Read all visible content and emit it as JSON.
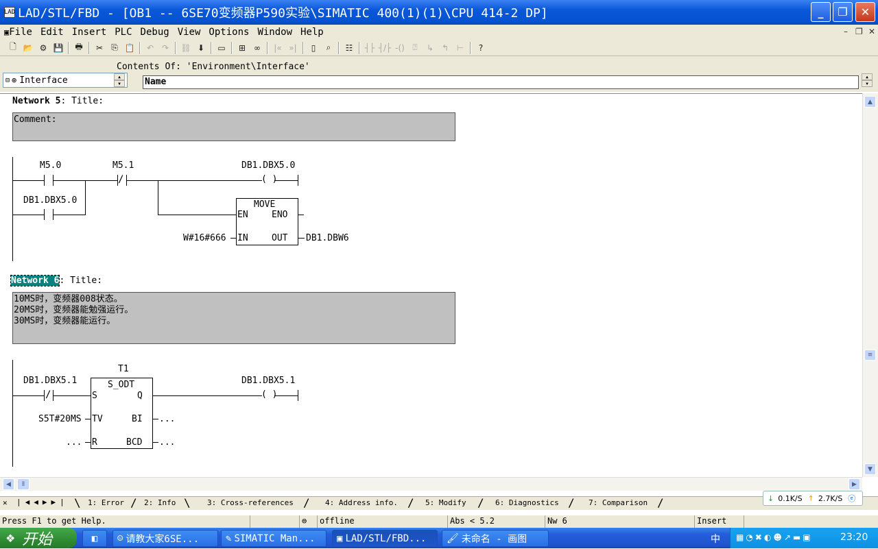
{
  "window": {
    "title": "LAD/STL/FBD  - [OB1 -- 6SE70变频器P590实验\\SIMATIC 400(1)(1)\\CPU 414-2 DP]"
  },
  "menu": [
    "File",
    "Edit",
    "Insert",
    "PLC",
    "Debug",
    "View",
    "Options",
    "Window",
    "Help"
  ],
  "interface": {
    "tree_label": "Interface",
    "contents_of": "Contents Of: 'Environment\\Interface'",
    "name_header": "Name"
  },
  "network5": {
    "title_prefix": "Network 5",
    "title_suffix": ": Title:",
    "comment": "Comment:",
    "contact1": "M5.0",
    "contact2": "M5.1",
    "contact3": "DB1.DBX5.0",
    "coil": "DB1.DBX5.0",
    "move": {
      "name": "MOVE",
      "en": "EN",
      "eno": "ENO",
      "in": "IN",
      "out": "OUT",
      "in_value": "W#16#666",
      "out_value": "DB1.DBW6"
    }
  },
  "network6": {
    "title_prefix": "Network 6",
    "title_suffix": ": Title:",
    "comment": "10MS时，变频器008状态。\n20MS时，变频器能勉强运行。\n30MS时，变频器能运行。",
    "contact": "DB1.DBX5.1",
    "coil": "DB1.DBX5.1",
    "timer": "T1",
    "box": {
      "name": "S_ODT",
      "s": "S",
      "q": "Q",
      "tv": "TV",
      "bi": "BI",
      "r": "R",
      "bcd": "BCD",
      "tv_value": "S5T#20MS",
      "r_value": "...",
      "bi_value": "...",
      "bcd_value": "..."
    }
  },
  "tabs": [
    "1: Error",
    "2: Info",
    "3: Cross-references",
    "4: Address info.",
    "5: Modify",
    "6: Diagnostics",
    "7: Comparison"
  ],
  "status": {
    "help": "Press F1 to get Help.",
    "mode": "offline",
    "abs": "Abs < 5.2",
    "nw": "Nw 6",
    "insert": "Insert"
  },
  "net": {
    "down": "0.1K/S",
    "up": "2.7K/S"
  },
  "taskbar": {
    "start": "开始",
    "items": [
      "请教大家6SE...",
      "SIMATIC Man...",
      "LAD/STL/FBD...",
      "未命名 - 画图"
    ],
    "ime": "中",
    "time": "23:20"
  },
  "colors": {
    "titlebar": "#0a58d8",
    "selection": "#0a8080",
    "comment_bg": "#c0c0c0"
  }
}
